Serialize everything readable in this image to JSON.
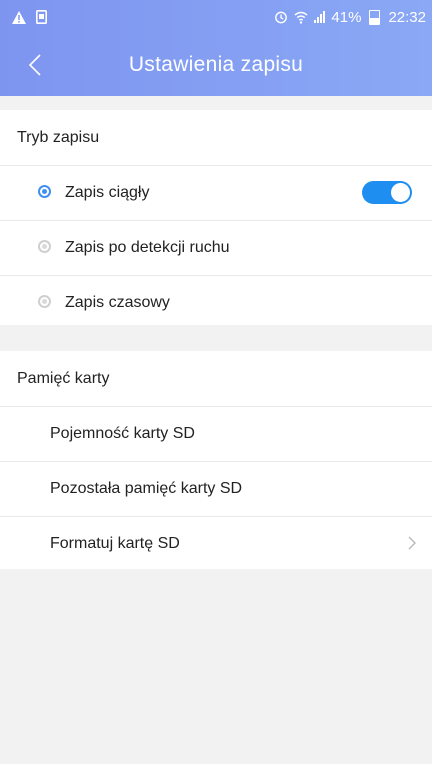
{
  "status_bar": {
    "time": "22:32",
    "battery": "41%"
  },
  "header": {
    "title": "Ustawienia zapisu"
  },
  "record_mode": {
    "title": "Tryb zapisu",
    "options": [
      {
        "label": "Zapis ciągły",
        "selected": true,
        "toggle_on": true
      },
      {
        "label": "Zapis po detekcji ruchu",
        "selected": false
      },
      {
        "label": "Zapis czasowy",
        "selected": false
      }
    ]
  },
  "card_memory": {
    "title": "Pamięć karty",
    "items": [
      {
        "label": "Pojemność karty SD"
      },
      {
        "label": "Pozostała pamięć karty SD"
      },
      {
        "label": "Formatuj kartę SD",
        "has_chevron": true
      }
    ]
  },
  "colors": {
    "accent": "#1e8ff0",
    "header": "#8aa8f5",
    "background": "#f2f2f2"
  }
}
